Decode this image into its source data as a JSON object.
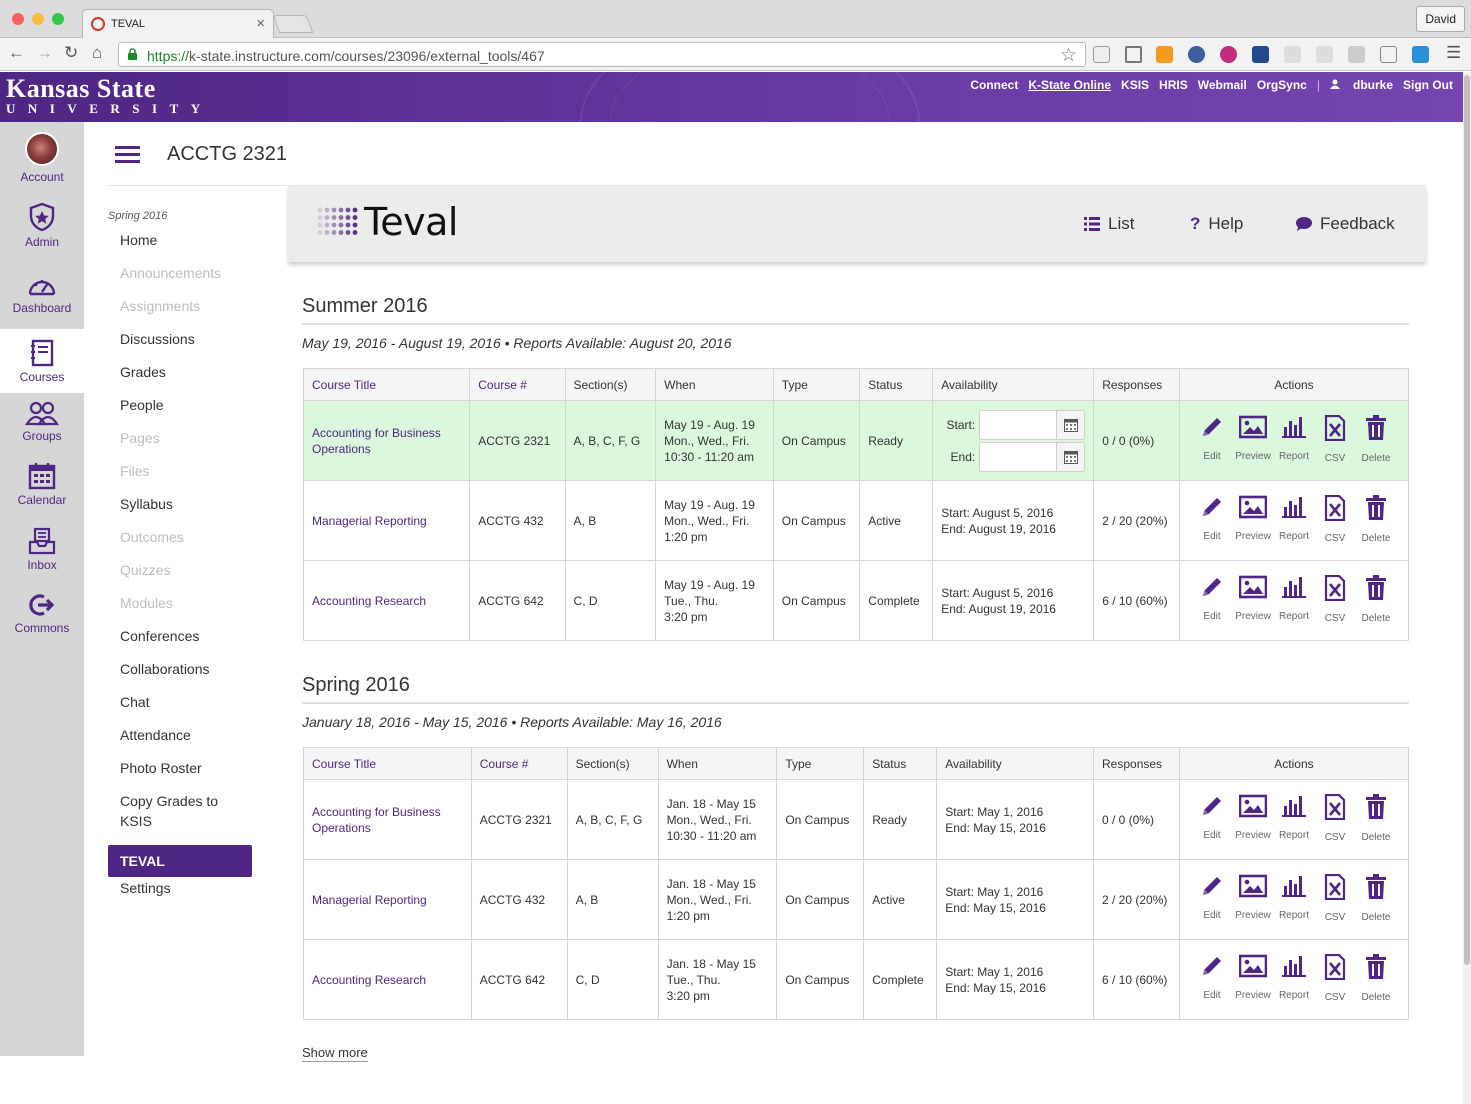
{
  "browser": {
    "tab_title": "TEVAL",
    "tab_close": "×",
    "profile": "David",
    "url_scheme": "https://",
    "url_rest": "k-state.instructure.com/courses/23096/external_tools/467"
  },
  "ksu": {
    "logo_line1": "Kansas State",
    "logo_line2": "UNIVERSITY",
    "links": [
      "Connect",
      "K-State Online",
      "KSIS",
      "HRIS",
      "Webmail",
      "OrgSync"
    ],
    "user": "dburke",
    "sign_out": "Sign Out"
  },
  "global_nav": [
    "Account",
    "Admin",
    "Dashboard",
    "Courses",
    "Groups",
    "Calendar",
    "Inbox",
    "Commons"
  ],
  "course": {
    "title": "ACCTG 2321",
    "term": "Spring 2016",
    "nav": [
      {
        "label": "Home",
        "state": "enabled"
      },
      {
        "label": "Announcements",
        "state": "disabled"
      },
      {
        "label": "Assignments",
        "state": "disabled"
      },
      {
        "label": "Discussions",
        "state": "enabled"
      },
      {
        "label": "Grades",
        "state": "enabled"
      },
      {
        "label": "People",
        "state": "enabled"
      },
      {
        "label": "Pages",
        "state": "disabled"
      },
      {
        "label": "Files",
        "state": "disabled"
      },
      {
        "label": "Syllabus",
        "state": "enabled"
      },
      {
        "label": "Outcomes",
        "state": "disabled"
      },
      {
        "label": "Quizzes",
        "state": "disabled"
      },
      {
        "label": "Modules",
        "state": "disabled"
      },
      {
        "label": "Conferences",
        "state": "enabled"
      },
      {
        "label": "Collaborations",
        "state": "enabled"
      },
      {
        "label": "Chat",
        "state": "enabled"
      },
      {
        "label": "Attendance",
        "state": "enabled"
      },
      {
        "label": "Photo Roster",
        "state": "enabled"
      },
      {
        "label": "Copy Grades to KSIS",
        "state": "enabled"
      },
      {
        "label": "TEVAL",
        "state": "active"
      },
      {
        "label": "Settings",
        "state": "enabled"
      }
    ]
  },
  "teval": {
    "brand": "Teval",
    "list": "List",
    "help": "Help",
    "feedback": "Feedback"
  },
  "columns": [
    "Course Title",
    "Course #",
    "Section(s)",
    "When",
    "Type",
    "Status",
    "Availability",
    "Responses",
    "Actions"
  ],
  "action_labels": [
    "Edit",
    "Preview",
    "Report",
    "CSV",
    "Delete"
  ],
  "date_labels": {
    "start": "Start:",
    "end": "End:"
  },
  "terms": [
    {
      "title": "Summer 2016",
      "dates": "May 19, 2016 - August 19, 2016 • Reports Available: August 20, 2016",
      "rows": [
        {
          "title": "Accounting for Business Operations",
          "num": "ACCTG 2321",
          "sections": "A, B, C, F, G",
          "when": [
            "May 19 - Aug. 19",
            "Mon., Wed., Fri.",
            "10:30 - 11:20 am"
          ],
          "type": "On Campus",
          "status": "Ready",
          "avail": null,
          "responses": "0 / 0 (0%)"
        },
        {
          "title": "Managerial Reporting",
          "num": "ACCTG 432",
          "sections": "A, B",
          "when": [
            "May 19 - Aug. 19",
            "Mon., Wed., Fri.",
            "1:20 pm"
          ],
          "type": "On Campus",
          "status": "Active",
          "avail": [
            "Start: August 5, 2016",
            "End: August 19, 2016"
          ],
          "responses": "2 / 20 (20%)"
        },
        {
          "title": "Accounting Research",
          "num": "ACCTG 642",
          "sections": "C, D",
          "when": [
            "May 19 - Aug. 19",
            "Tue., Thu.",
            "3:20 pm"
          ],
          "type": "On Campus",
          "status": "Complete",
          "avail": [
            "Start: August 5, 2016",
            "End: August 19, 2016"
          ],
          "responses": "6 / 10 (60%)"
        }
      ]
    },
    {
      "title": "Spring 2016",
      "dates": "January 18, 2016 - May 15, 2016 • Reports Available: May 16, 2016",
      "rows": [
        {
          "title": "Accounting for Business Operations",
          "num": "ACCTG 2321",
          "sections": "A, B, C, F, G",
          "when": [
            "Jan. 18 - May 15",
            "Mon., Wed., Fri.",
            "10:30 - 11:20 am"
          ],
          "type": "On Campus",
          "status": "Ready",
          "avail": [
            "Start: May 1, 2016",
            "End: May 15, 2016"
          ],
          "responses": "0 / 0 (0%)"
        },
        {
          "title": "Managerial Reporting",
          "num": "ACCTG 432",
          "sections": "A, B",
          "when": [
            "Jan. 18 - May 15",
            "Mon., Wed., Fri.",
            "1:20 pm"
          ],
          "type": "On Campus",
          "status": "Active",
          "avail": [
            "Start: May 1, 2016",
            "End: May 15, 2016"
          ],
          "responses": "2 / 20 (20%)"
        },
        {
          "title": "Accounting Research",
          "num": "ACCTG 642",
          "sections": "C, D",
          "when": [
            "Jan. 18 - May 15",
            "Tue., Thu.",
            "3:20 pm"
          ],
          "type": "On Campus",
          "status": "Complete",
          "avail": [
            "Start: May 1, 2016",
            "End: May 15, 2016"
          ],
          "responses": "6 / 10 (60%)"
        }
      ]
    }
  ],
  "show_more": "Show more",
  "colors": {
    "brand": "#4f2683",
    "ready_row": "#dbf7dc"
  }
}
